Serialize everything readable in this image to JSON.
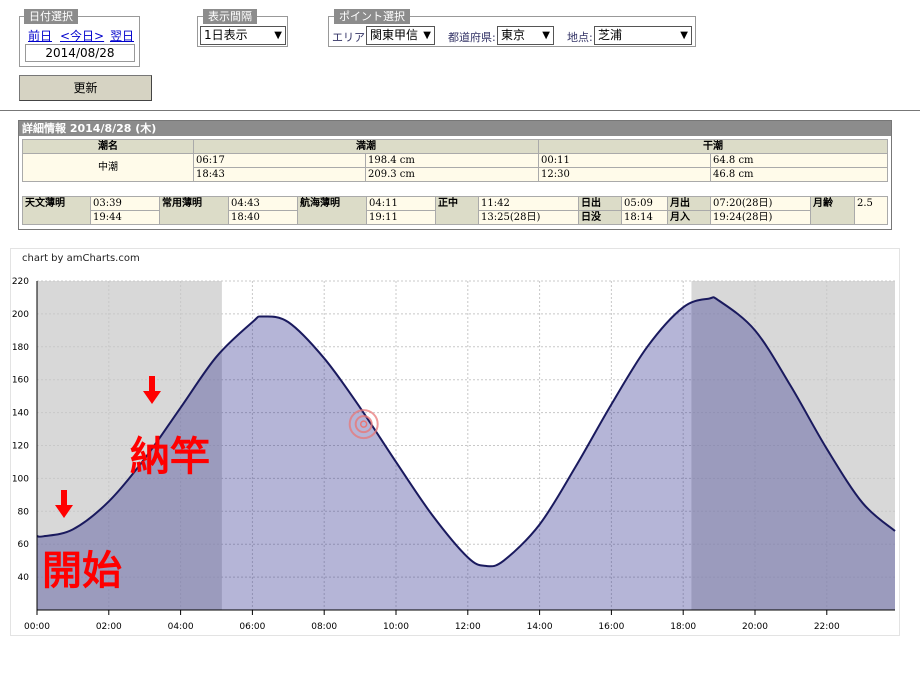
{
  "date_select": {
    "legend": "日付選択",
    "prev": "前日",
    "today": "<今日>",
    "next": "翌日",
    "date": "2014/08/28"
  },
  "interval": {
    "legend": "表示間隔",
    "value": "1日表示"
  },
  "point": {
    "legend": "ポイント選択",
    "area_label": "エリア:",
    "area_value": "関東甲信",
    "pref_label": "都道府県:",
    "pref_value": "東京",
    "spot_label": "地点:",
    "spot_value": "芝浦"
  },
  "update_label": "更新",
  "detail": {
    "title": "詳細情報  2014/8/28 (木)",
    "headers": [
      "潮名",
      "満潮",
      "干潮"
    ],
    "tide_name": "中潮",
    "high": [
      {
        "time": "06:17",
        "level": "198.4 cm"
      },
      {
        "time": "18:43",
        "level": "209.3 cm"
      }
    ],
    "low": [
      {
        "time": "00:11",
        "level": "64.8 cm"
      },
      {
        "time": "12:30",
        "level": "46.8 cm"
      }
    ],
    "astro": {
      "astro_twilight": {
        "label": "天文薄明",
        "v1": "03:39",
        "v2": "19:44"
      },
      "civil_twilight": {
        "label": "常用薄明",
        "v1": "04:43",
        "v2": "18:40"
      },
      "nautical_twilight": {
        "label": "航海薄明",
        "v1": "04:11",
        "v2": "19:11"
      },
      "noon": {
        "label": "正中",
        "v1": "11:42",
        "v2": "13:25(28日)"
      },
      "sunrise": {
        "label": "日出",
        "value": "05:09"
      },
      "sunset": {
        "label": "日没",
        "value": "18:14"
      },
      "moonrise": {
        "label": "月出",
        "value": "07:20(28日)"
      },
      "moonset": {
        "label": "月入",
        "value": "19:24(28日)"
      },
      "moon_age": {
        "label": "月齢",
        "value": "2.5"
      }
    }
  },
  "credit": "chart by amCharts.com",
  "annotations": {
    "start": "開始",
    "end": "納竿"
  },
  "chart_data": {
    "type": "area",
    "x_unit": "hour",
    "x_ticks": [
      "00:00",
      "02:00",
      "04:00",
      "06:00",
      "08:00",
      "10:00",
      "12:00",
      "14:00",
      "16:00",
      "18:00",
      "20:00",
      "22:00"
    ],
    "y_ticks": [
      40,
      60,
      80,
      100,
      120,
      140,
      160,
      180,
      200,
      220
    ],
    "ylim": [
      20,
      220
    ],
    "xlim": [
      0,
      23.9
    ],
    "night_shading": [
      [
        0,
        5.15
      ],
      [
        18.23,
        23.9
      ]
    ],
    "series": [
      {
        "x": [
          0,
          0.18,
          1,
          2,
          3,
          4,
          5,
          6,
          6.28,
          7,
          8,
          9,
          10,
          11,
          12,
          12.5,
          13,
          14,
          15,
          16,
          17,
          18,
          18.72,
          19,
          20,
          21,
          22,
          23,
          23.9
        ],
        "y": [
          65,
          64.8,
          69,
          86,
          112,
          143,
          174,
          195,
          198.4,
          195,
          173,
          143,
          110,
          78,
          52,
          46.8,
          50,
          72,
          107,
          145,
          180,
          204,
          209.3,
          208,
          190,
          156,
          118,
          85,
          68
        ]
      }
    ],
    "marker": {
      "x": 9.1,
      "y": 133
    }
  }
}
